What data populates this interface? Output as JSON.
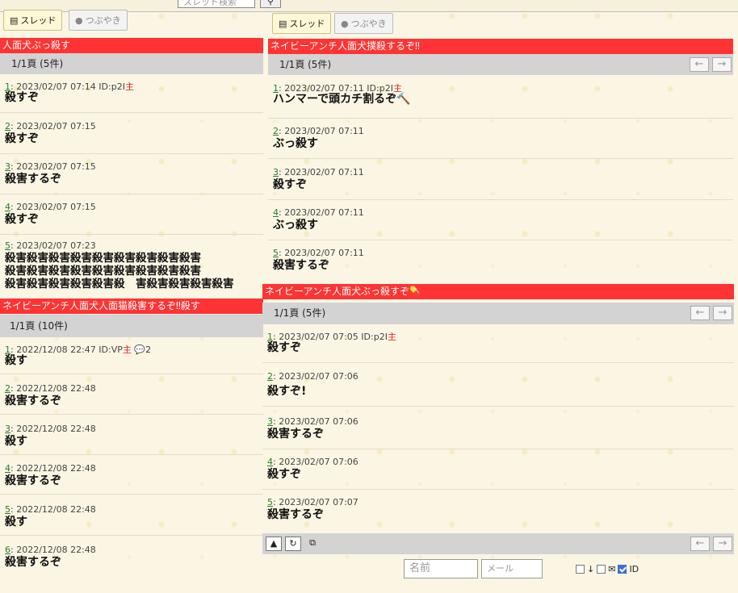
{
  "topbar": {
    "search_placeholder": "スレッド検索",
    "search_icon": "search-icon"
  },
  "left": {
    "tabs": {
      "thread_label": "スレッド",
      "tweet_label": "つぶやき"
    },
    "threads": [
      {
        "title": "人面犬ぶっ殺す",
        "page": "1/1頁 (5件)",
        "posts": [
          {
            "num": "1",
            "date": ": 2023/02/07 07:14 ID:p2I",
            "owner": "主",
            "body": [
              "殺すぞ"
            ]
          },
          {
            "num": "2",
            "date": ": 2023/02/07 07:15",
            "body": [
              "殺すぞ"
            ]
          },
          {
            "num": "3",
            "date": ": 2023/02/07 07:15",
            "body": [
              "殺害するぞ"
            ]
          },
          {
            "num": "4",
            "date": ": 2023/02/07 07:15",
            "body": [
              "殺すぞ"
            ]
          },
          {
            "num": "5",
            "date": ": 2023/02/07 07:23",
            "body": [
              "殺害殺害殺害殺害殺害殺害殺害殺害殺害",
              "殺害殺害殺害殺害殺害殺害殺害殺害殺害",
              "殺害殺害殺害殺害殺害殺　害殺害殺害殺害殺害"
            ]
          }
        ]
      },
      {
        "title": "ネイビーアンチ人面犬人面猫殺害するぞ‼殺す",
        "page": "1/1頁 (10件)",
        "posts": [
          {
            "num": "1",
            "date": ": 2022/12/08 22:47 ID:VP",
            "owner": "主",
            "reply": "2",
            "body": [
              "殺す"
            ]
          },
          {
            "num": "2",
            "date": ": 2022/12/08 22:48",
            "body": [
              "殺害するぞ"
            ]
          },
          {
            "num": "3",
            "date": ": 2022/12/08 22:48",
            "body": [
              "殺す"
            ]
          },
          {
            "num": "4",
            "date": ": 2022/12/08 22:48",
            "body": [
              "殺害するぞ"
            ]
          },
          {
            "num": "5",
            "date": ": 2022/12/08 22:48",
            "body": [
              "殺す"
            ]
          },
          {
            "num": "6",
            "date": ": 2022/12/08 22:48",
            "body": [
              "殺害するぞ"
            ]
          }
        ]
      }
    ]
  },
  "right": {
    "tabs": {
      "thread_label": "スレッド",
      "tweet_label": "つぶやき"
    },
    "threads": [
      {
        "title": "ネイビーアンチ人面犬撲殺するぞ‼",
        "page": "1/1頁 (5件)",
        "posts": [
          {
            "num": "1",
            "date": ": 2023/02/07 07:11 ID:p2I",
            "owner": "主",
            "body": [
              "ハンマーで頭カチ割るぞ🔨"
            ]
          },
          {
            "num": "2",
            "date": ": 2023/02/07 07:11",
            "body": [
              "ぶっ殺す"
            ]
          },
          {
            "num": "3",
            "date": ": 2023/02/07 07:11",
            "body": [
              "殺すぞ"
            ]
          },
          {
            "num": "4",
            "date": ": 2023/02/07 07:11",
            "body": [
              "ぶっ殺す"
            ]
          },
          {
            "num": "5",
            "date": ": 2023/02/07 07:11",
            "body": [
              "殺害するぞ"
            ]
          }
        ]
      },
      {
        "title": "ネイビーアンチ人面犬ぶっ殺すぞ💊",
        "page": "1/1頁 (5件)",
        "posts": [
          {
            "num": "1",
            "date": ": 2023/02/07 07:05 ID:p2I",
            "owner": "主",
            "body": [
              "殺すぞ"
            ]
          },
          {
            "num": "2",
            "date": ": 2023/02/07 07:06",
            "body": [
              "殺すぞ!"
            ]
          },
          {
            "num": "3",
            "date": ": 2023/02/07 07:06",
            "body": [
              "殺害するぞ"
            ]
          },
          {
            "num": "4",
            "date": ": 2023/02/07 07:06",
            "body": [
              "殺すぞ"
            ]
          },
          {
            "num": "5",
            "date": ": 2023/02/07 07:07",
            "body": [
              "殺害するぞ"
            ]
          }
        ]
      }
    ],
    "arrows": {
      "prev": "←",
      "next": "→"
    },
    "tools": {
      "up": "▲",
      "refresh": "↻",
      "gallery": "⧉"
    },
    "form": {
      "name_placeholder": "名前",
      "mail_placeholder": "メール",
      "check_down": "↓",
      "check_mail": "✉",
      "check_id": "ID"
    }
  }
}
